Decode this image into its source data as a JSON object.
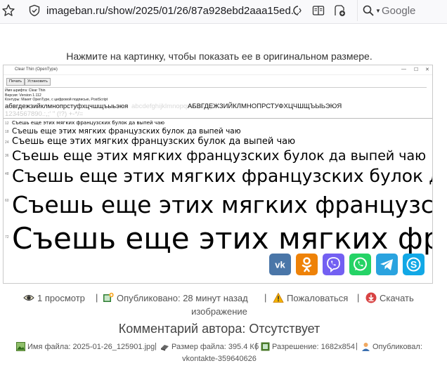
{
  "browser": {
    "url": "imageban.ru/show/2025/01/26/87a928ebd2aaa15ed...",
    "search_placeholder": "Google",
    "icons": [
      "star-icon",
      "shield-icon",
      "reader-icon",
      "add-tab-icon",
      "search-icon"
    ]
  },
  "page": {
    "hint": "Нажмите на картинку, чтобы показать ее в оригинальном размере."
  },
  "image": {
    "window_title": "Clear Thin (OpenType)",
    "buttons": [
      "Печать",
      "Установить"
    ],
    "font_name": "Имя шрифта: Clear Thin",
    "version": "Версия: Version 1.112",
    "outlines": "Контуры: Макет OpenType, с цифровой подписью, PostScript",
    "alphabet_lower": "абвгдежзийклмнопрстуфхцчшщъыьэюя",
    "alphabet_upper": "АБВГДЕЖЗИЙКЛМНОПРСТУФХЦЧШЩЪЫЬЭЮЯ",
    "alphabet_lower_faint": "abcdefghijklmnopqrstuvwxyz",
    "alphabet_digits_faint": "1234567890.:,;' \" (!?) +-*/=",
    "sample_text": "Съешь еще этих мягких французских булок да выпей чаю",
    "sizes": [
      "12",
      "18",
      "24",
      "36",
      "48",
      "60",
      "72"
    ]
  },
  "share": {
    "items": [
      "vk",
      "odnoklassniki",
      "viber",
      "whatsapp",
      "telegram",
      "skype"
    ],
    "colors": [
      "#4a76a8",
      "#ee8208",
      "#7360f2",
      "#25d366",
      "#2aa3df",
      "#12a8e6"
    ]
  },
  "meta": {
    "views": "1 просмотр",
    "published": "Опубликовано: 28 минут назад",
    "report": "Пожаловаться",
    "download": "Скачать",
    "download_line2": "изображение",
    "separator": "|"
  },
  "comment": "Комментарий автора: Отсутствует",
  "fileinfo": {
    "filename": "Имя файла: 2025-01-26_125901.jpg",
    "filesize": "Размер файла: 395.4 Кб",
    "resolution": "Разрешение: 1682x854",
    "uploader": "Опубликовал:",
    "uploader_name": "vkontakte-359640626",
    "separator": "|"
  }
}
